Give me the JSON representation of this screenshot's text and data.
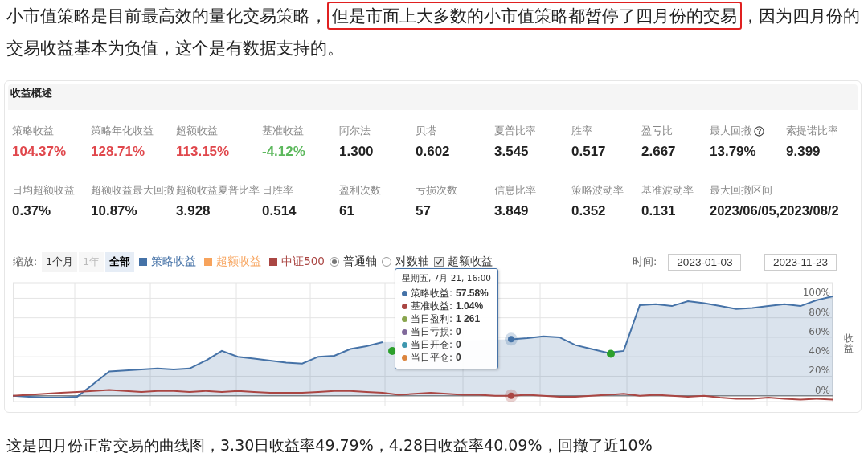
{
  "intro": {
    "before": "小市值策略是目前最高效的量化交易策略，",
    "highlight": "但是市面上大多数的小市值策略都暂停了四月份的交易",
    "after": "，因为四月份的交易收益基本为负值，这个是有数据支持的。"
  },
  "summary": {
    "title": "收益概述",
    "rows": [
      [
        {
          "label": "策略收益",
          "value": "104.37%",
          "color": "#e0474c",
          "help": false
        },
        {
          "label": "策略年化收益",
          "value": "128.71%",
          "color": "#e0474c",
          "help": false
        },
        {
          "label": "超额收益",
          "value": "113.15%",
          "color": "#e0474c",
          "help": false
        },
        {
          "label": "基准收益",
          "value": "-4.12%",
          "color": "#5cb85c",
          "help": false
        },
        {
          "label": "阿尔法",
          "value": "1.300",
          "help": false
        },
        {
          "label": "贝塔",
          "value": "0.602",
          "help": false
        },
        {
          "label": "夏普比率",
          "value": "3.545",
          "help": false
        },
        {
          "label": "胜率",
          "value": "0.517",
          "help": false
        },
        {
          "label": "盈亏比",
          "value": "2.667",
          "help": false
        },
        {
          "label": "最大回撤",
          "value": "13.79%",
          "help": true
        },
        {
          "label": "索提诺比率",
          "value": "9.399",
          "help": false
        }
      ],
      [
        {
          "label": "日均超额收益",
          "value": "0.37%",
          "help": false
        },
        {
          "label": "超额收益最大回撤",
          "value": "10.87%",
          "help": false
        },
        {
          "label": "超额收益夏普比率",
          "value": "3.928",
          "help": false
        },
        {
          "label": "日胜率",
          "value": "0.514",
          "help": false
        },
        {
          "label": "盈利次数",
          "value": "61",
          "help": false
        },
        {
          "label": "亏损次数",
          "value": "57",
          "help": false
        },
        {
          "label": "信息比率",
          "value": "3.849",
          "help": false
        },
        {
          "label": "策略波动率",
          "value": "0.352",
          "help": false
        },
        {
          "label": "基准波动率",
          "value": "0.131",
          "help": false
        },
        {
          "label": "最大回撤区间",
          "value": "2023/06/05,2023/08/2",
          "help": false
        }
      ]
    ]
  },
  "chart_panel": {
    "zoom_label": "缩放:",
    "zoom_buttons": [
      {
        "label": "1个月",
        "selected": false,
        "disabled": false
      },
      {
        "label": "1年",
        "selected": false,
        "disabled": true
      },
      {
        "label": "全部",
        "selected": true,
        "disabled": false
      }
    ],
    "legend": [
      {
        "label": "策略收益",
        "color": "#4572a7"
      },
      {
        "label": "超额收益",
        "color": "#f7a35c"
      },
      {
        "label": "中证500",
        "color": "#aa4643"
      }
    ],
    "axis_modes": [
      {
        "label": "普通轴",
        "selected": true
      },
      {
        "label": "对数轴",
        "selected": false
      }
    ],
    "excess_toggle": {
      "label": "超额收益",
      "checked": true
    },
    "time_label": "时间:",
    "start_date": "2023-01-03",
    "date_separator": "-",
    "end_date": "2023-11-23",
    "tooltip": {
      "title": "星期五, 7月 21, 16:00",
      "rows": [
        {
          "label": "策略收益:",
          "value": "57.58%",
          "color": "#4572a7"
        },
        {
          "label": "基准收益:",
          "value": "1.04%",
          "color": "#aa4643"
        },
        {
          "label": "当日盈利:",
          "value": "1 261",
          "color": "#89a54e"
        },
        {
          "label": "当日亏损:",
          "value": "0",
          "color": "#80699b"
        },
        {
          "label": "当日开仓:",
          "value": "0",
          "color": "#3d96ae"
        },
        {
          "label": "当日平仓:",
          "value": "0",
          "color": "#db843d"
        }
      ]
    },
    "chart_data": {
      "type": "line",
      "ylabel": "收益",
      "grid": true,
      "ylim": [
        -6,
        116
      ],
      "yticks": [
        {
          "value": 0,
          "label": "0%"
        },
        {
          "value": 20,
          "label": "20%"
        },
        {
          "value": 40,
          "label": "40%"
        },
        {
          "value": 60,
          "label": "60%"
        },
        {
          "value": 80,
          "label": "80%"
        },
        {
          "value": 100,
          "label": "100%"
        }
      ],
      "series": [
        {
          "type": "area",
          "color": "#4572a7",
          "values": [
            0,
            -1,
            -2,
            -2,
            -1,
            12,
            25,
            26,
            27,
            28,
            27,
            28,
            36,
            46,
            40,
            38,
            36,
            34,
            33,
            40,
            41,
            48,
            51,
            55,
            null,
            null,
            null,
            null,
            null,
            null,
            null,
            58,
            59,
            61,
            60,
            52,
            48,
            44,
            46,
            93,
            94,
            92,
            97,
            95,
            92,
            89,
            90,
            92,
            94,
            92,
            98,
            102
          ]
        },
        {
          "type": "line",
          "color": "#aa4643",
          "values": [
            0,
            1,
            2,
            3,
            4,
            5,
            6,
            5,
            4,
            5,
            5,
            4,
            5,
            4,
            5,
            4,
            3,
            3,
            3,
            4,
            5,
            5,
            4,
            3,
            1,
            2,
            3,
            2,
            1,
            1,
            0,
            0,
            1,
            0,
            -1,
            -1,
            0,
            1,
            2,
            0,
            1,
            0,
            -1,
            0,
            -2,
            -3,
            -3,
            -2,
            -3,
            -4,
            -3,
            -4
          ]
        }
      ]
    }
  },
  "caption": "这是四月份正常交易的曲线图，3.30日收益率49.79%，4.28日收益率40.09%，回撤了近10%"
}
